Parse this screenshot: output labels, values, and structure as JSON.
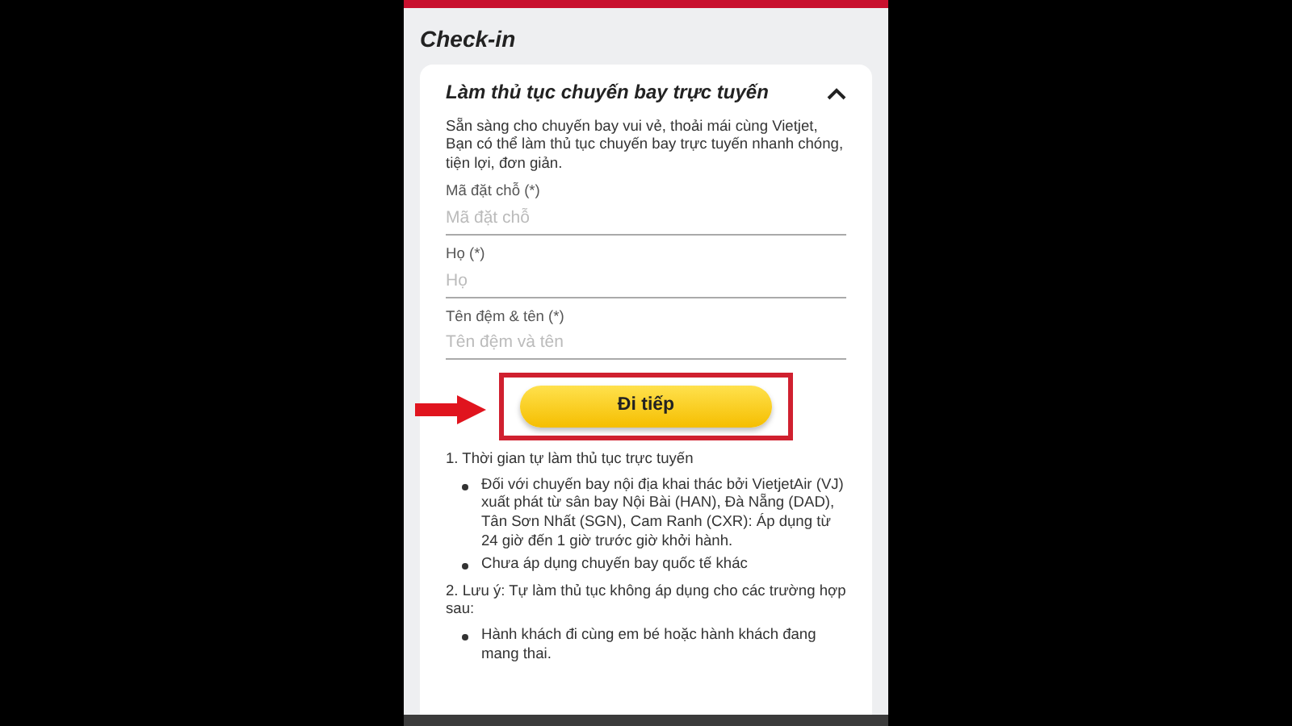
{
  "header": {
    "title": "Check-in"
  },
  "card": {
    "title": "Làm thủ tục chuyến bay trực tuyến",
    "expanded": true,
    "description": "Sẵn sàng cho chuyến bay vui vẻ, thoải mái cùng Vietjet, Bạn có thể làm thủ tục chuyến bay trực tuyến nhanh chóng, tiện lợi, đơn giản."
  },
  "fields": [
    {
      "label": "Mã đặt chỗ (*)",
      "placeholder": "Mã đặt chỗ"
    },
    {
      "label": "Họ (*)",
      "placeholder": "Họ"
    },
    {
      "label": "Tên đệm & tên (*)",
      "placeholder": "Tên đệm và tên"
    }
  ],
  "button": {
    "label": "Đi tiếp"
  },
  "notes": [
    {
      "heading": "1. Thời gian tự làm thủ tục trực tuyến",
      "items": [
        "Đối với chuyến bay nội địa khai thác bởi VietjetAir (VJ) xuất phát từ sân bay Nội Bài (HAN), Đà Nẵng (DAD), Tân Sơn Nhất (SGN), Cam Ranh (CXR): Áp dụng từ 24 giờ đến 1 giờ trước giờ khởi hành.",
        "Chưa áp dụng chuyến bay quốc tế khác"
      ]
    },
    {
      "heading": "2. Lưu ý: Tự làm thủ tục không áp dụng cho các trường hợp sau:",
      "items": [
        "Hành khách đi cùng em bé hoặc hành khách đang mang thai."
      ]
    }
  ]
}
